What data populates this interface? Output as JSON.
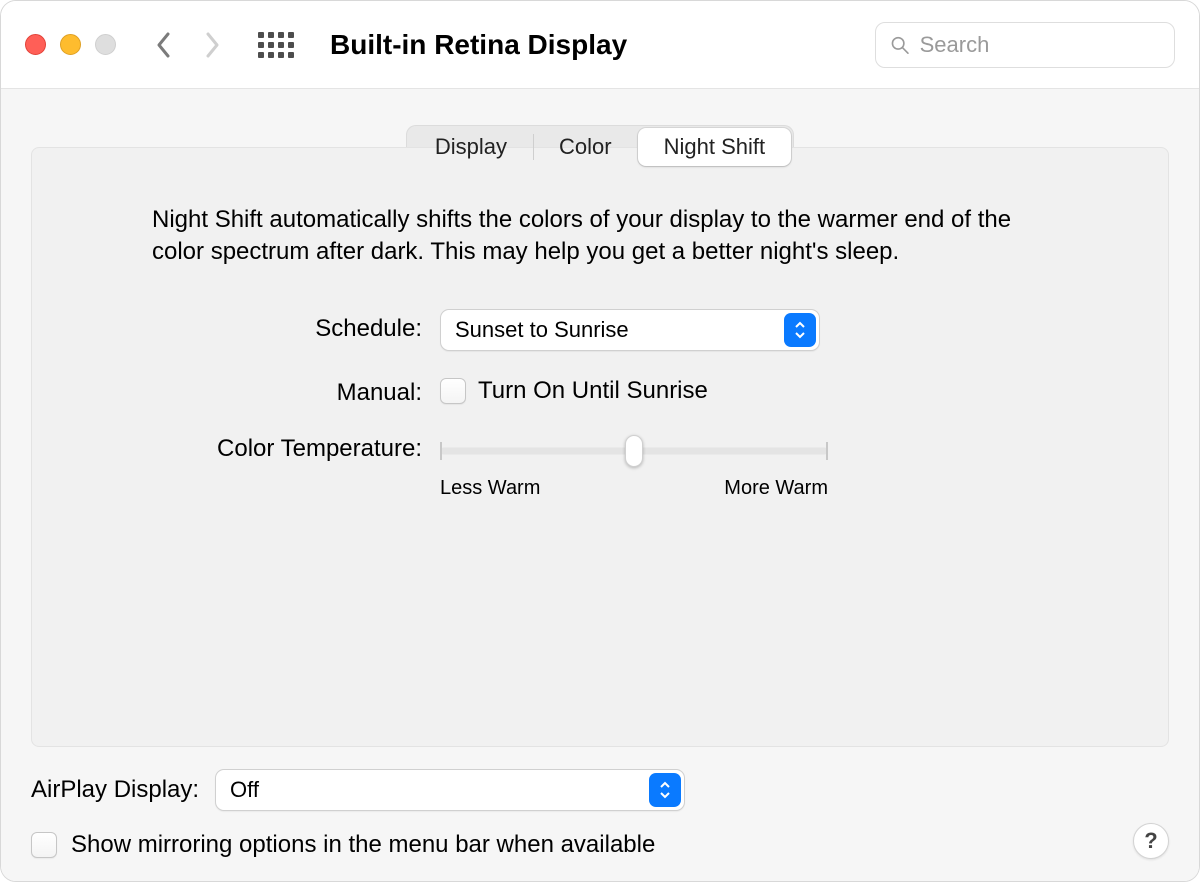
{
  "header": {
    "title": "Built-in Retina Display",
    "search_placeholder": "Search"
  },
  "tabs": {
    "items": [
      "Display",
      "Color",
      "Night Shift"
    ],
    "active_index": 2
  },
  "night_shift": {
    "description": "Night Shift automatically shifts the colors of your display to the warmer end of the color spectrum after dark. This may help you get a better night's sleep.",
    "schedule": {
      "label": "Schedule:",
      "value": "Sunset to Sunrise"
    },
    "manual": {
      "label": "Manual:",
      "checkbox_label": "Turn On Until Sunrise",
      "checked": false
    },
    "color_temp": {
      "label": "Color Temperature:",
      "min_label": "Less Warm",
      "max_label": "More Warm",
      "value_percent": 50
    }
  },
  "airplay": {
    "label": "AirPlay Display:",
    "value": "Off"
  },
  "mirroring": {
    "checkbox_label": "Show mirroring options in the menu bar when available",
    "checked": false
  },
  "help_button": "?"
}
